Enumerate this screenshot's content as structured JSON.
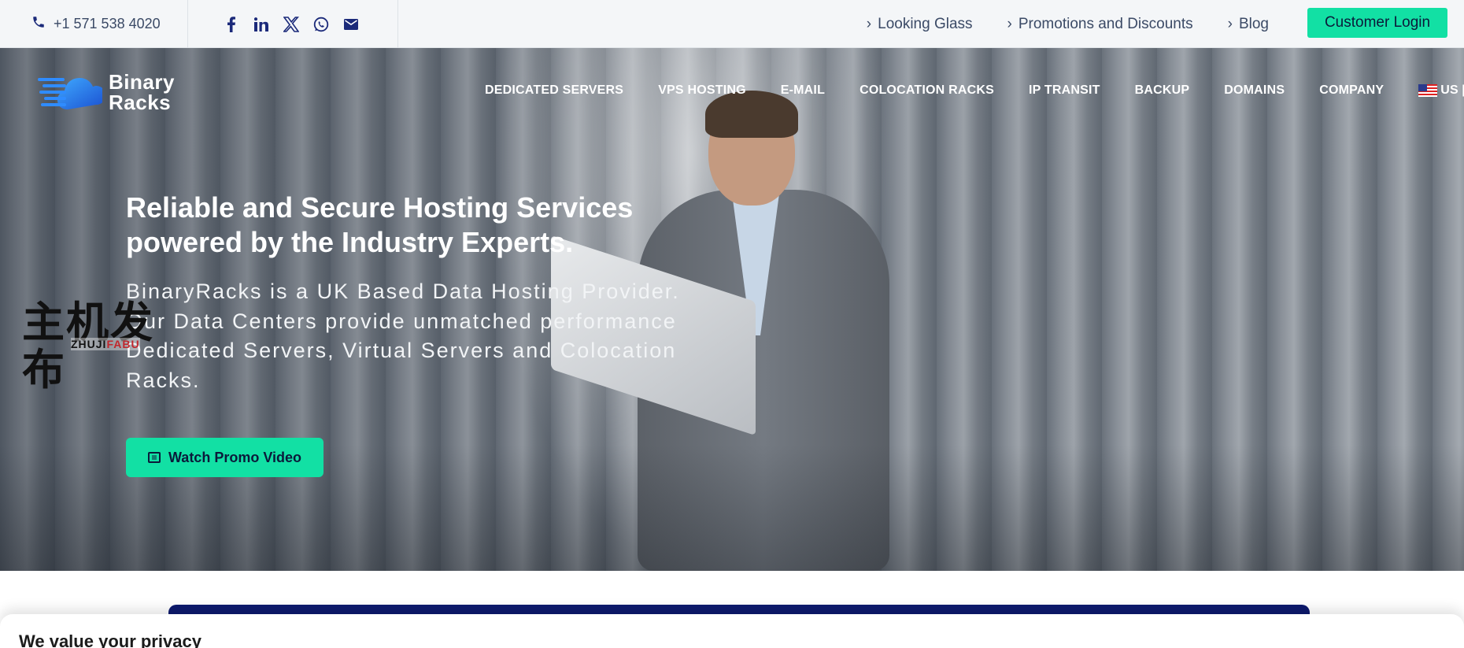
{
  "topbar": {
    "phone": "+1 571 538 4020",
    "social": [
      "facebook-icon",
      "linkedin-icon",
      "x-icon",
      "whatsapp-icon",
      "email-icon"
    ],
    "links": [
      {
        "label": "Looking Glass"
      },
      {
        "label": "Promotions and Discounts"
      },
      {
        "label": "Blog"
      }
    ],
    "login_label": "Customer Login"
  },
  "logo": {
    "line1": "Binary",
    "line2": "Racks"
  },
  "nav": {
    "items": [
      "DEDICATED SERVERS",
      "VPS HOSTING",
      "E-MAIL",
      "COLOCATION RACKS",
      "IP TRANSIT",
      "BACKUP",
      "DOMAINS",
      "COMPANY"
    ],
    "lang": "US [$]"
  },
  "hero": {
    "title": "Reliable and Secure Hosting Services powered by the Industry Experts.",
    "subtitle": "BinaryRacks is a UK Based Data Hosting Provider. Our Data Centers provide unmatched performance Dedicated Servers, Virtual Servers and Colocation Racks.",
    "cta_label": "Watch Promo Video"
  },
  "watermark": {
    "cn": "主机发布",
    "en_black": "ZHUJI",
    "en_red": "FABU"
  },
  "cookie": {
    "title": "We value your privacy"
  },
  "colors": {
    "accent": "#12e0a4",
    "navy": "#0d1a6e",
    "topbar_bg": "#f4f6f8"
  }
}
